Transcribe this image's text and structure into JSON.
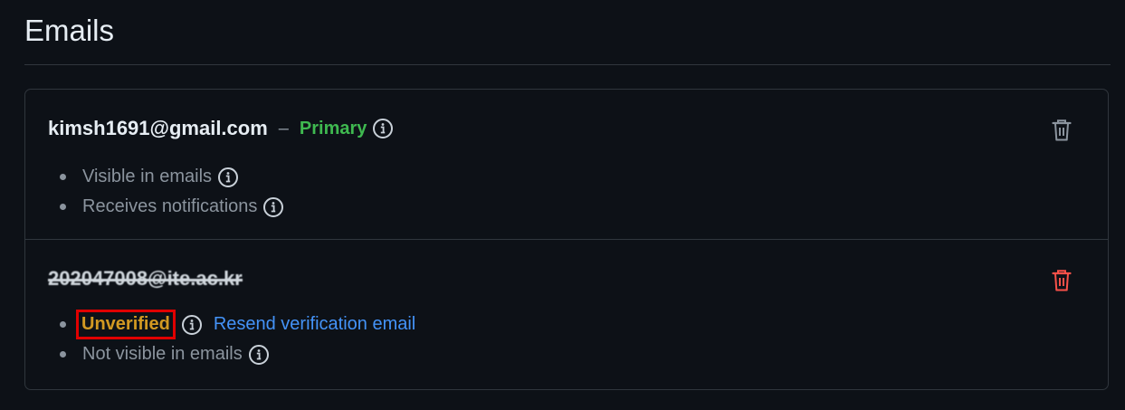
{
  "page": {
    "title": "Emails"
  },
  "emails": [
    {
      "address": "kimsh1691@gmail.com",
      "separator": "–",
      "primary_label": "Primary",
      "attributes": [
        "Visible in emails",
        "Receives notifications"
      ],
      "delete_icon": "trash-icon",
      "delete_color": "#8b949e"
    },
    {
      "address": "202047008@ite.ac.kr",
      "redacted": true,
      "unverified_label": "Unverified",
      "resend_label": "Resend verification email",
      "attributes": [
        "Not visible in emails"
      ],
      "delete_icon": "trash-icon",
      "delete_color": "#f85149"
    }
  ],
  "colors": {
    "background": "#0d1117",
    "border": "#30363d",
    "primary": "#3fb950",
    "unverified": "#d29922",
    "link": "#4493f8",
    "highlight_box": "#e00000",
    "muted_text": "#8b949e"
  }
}
